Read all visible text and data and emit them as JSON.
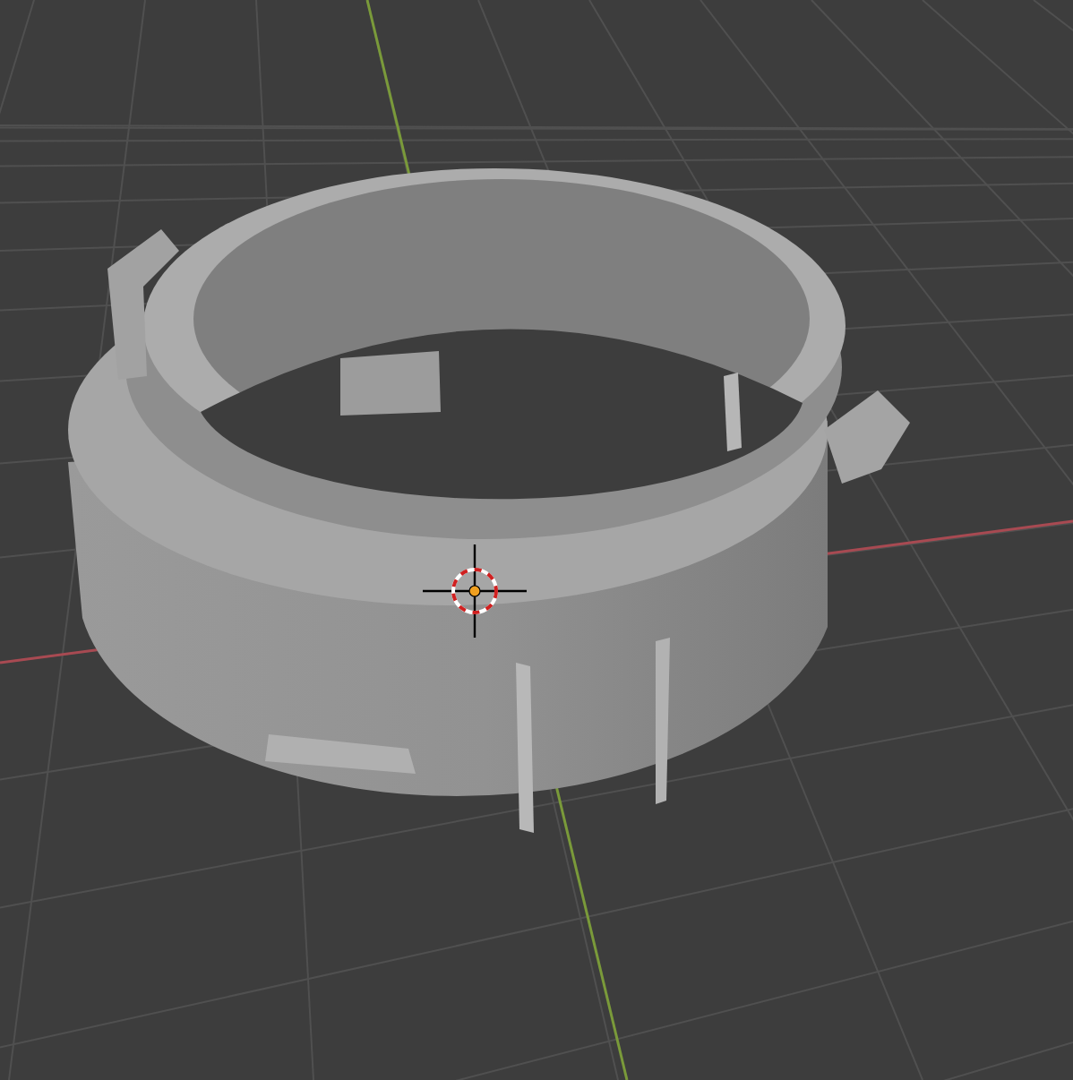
{
  "viewport": {
    "kind": "perspective",
    "cursor": true
  }
}
